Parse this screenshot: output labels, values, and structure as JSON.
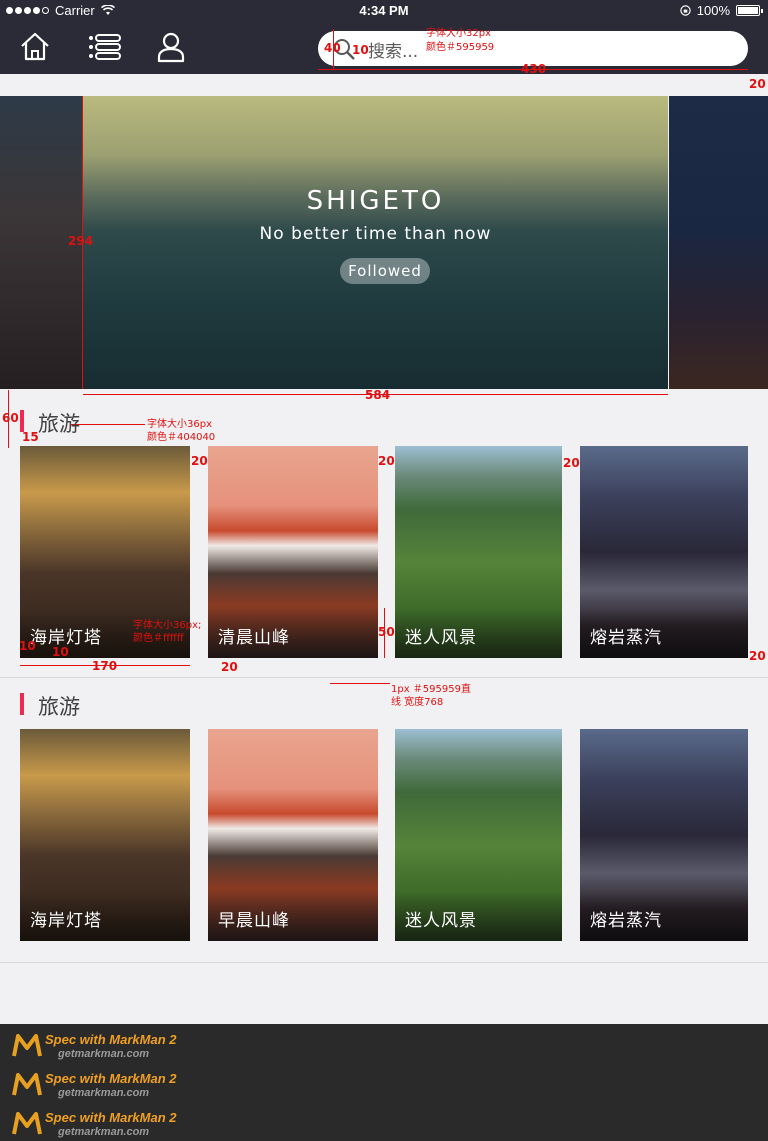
{
  "status_bar": {
    "carrier": "Carrier",
    "time": "4:34 PM",
    "battery": "100%"
  },
  "nav": {
    "icons": [
      "home-icon",
      "list-menu-icon",
      "user-icon"
    ],
    "search_placeholder": "搜索..."
  },
  "banner": {
    "title": "SHIGETO",
    "subtitle": "No better time than now",
    "follow_label": "Followed"
  },
  "sections": [
    {
      "title": "旅游",
      "cards": [
        {
          "label": "海岸灯塔"
        },
        {
          "label": "清晨山峰"
        },
        {
          "label": "迷人风景"
        },
        {
          "label": "熔岩蒸汽"
        }
      ]
    },
    {
      "title": "旅游",
      "cards": [
        {
          "label": "海岸灯塔"
        },
        {
          "label": "早晨山峰"
        },
        {
          "label": "迷人风景"
        },
        {
          "label": "熔岩蒸汽"
        }
      ]
    }
  ],
  "annotations": {
    "search_font": "字体大小32px",
    "search_color": "颜色＃595959",
    "search_h": "40",
    "search_pad": "10",
    "search_w": "430",
    "gap_20": "20",
    "banner_h": "294",
    "banner_w": "584",
    "title_font": "字体大小36px",
    "title_color": "颜色＃404040",
    "gap_60": "60",
    "gap_15": "15",
    "card_font": "字体大小36px;",
    "card_color": "颜色＃ffffff",
    "pad_10": "10",
    "card_w": "170",
    "cap_h": "50",
    "line_note_1": "1px ＃595959直",
    "line_note_2": "线 宽度768"
  },
  "footer": {
    "brand_prefix": "Spec with ",
    "brand_name": "MarkMan 2",
    "url": "getmarkman.com"
  },
  "colors": {
    "navbar": "#2b2b38",
    "accent": "#ec2b55",
    "title_text": "#404040",
    "placeholder": "#595959"
  }
}
